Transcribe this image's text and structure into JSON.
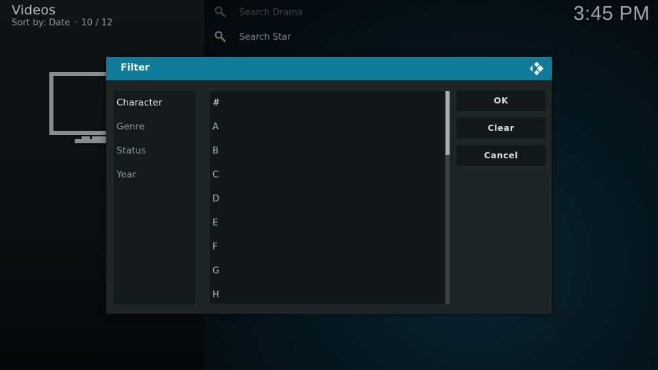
{
  "header": {
    "title": "Videos",
    "sort_label": "Sort by: Date",
    "separator": "·",
    "position": "10 / 12"
  },
  "clock": "3:45 PM",
  "search_items": [
    {
      "label": "Search Drama",
      "icon": "search-icon"
    },
    {
      "label": "Search Star",
      "icon": "search-icon"
    }
  ],
  "background_icon": "tv-icon",
  "dialog": {
    "title": "Filter",
    "logo": "kodi-logo-icon",
    "accent_color": "#117b9a",
    "categories": [
      {
        "label": "Character",
        "selected": true
      },
      {
        "label": "Genre",
        "selected": false
      },
      {
        "label": "Status",
        "selected": false
      },
      {
        "label": "Year",
        "selected": false
      }
    ],
    "options": [
      "#",
      "A",
      "B",
      "C",
      "D",
      "E",
      "F",
      "G",
      "H"
    ],
    "scroll_position_fraction": 0.0,
    "scroll_visible_fraction": 0.3,
    "buttons": {
      "ok": "OK",
      "clear": "Clear",
      "cancel": "Cancel"
    }
  }
}
